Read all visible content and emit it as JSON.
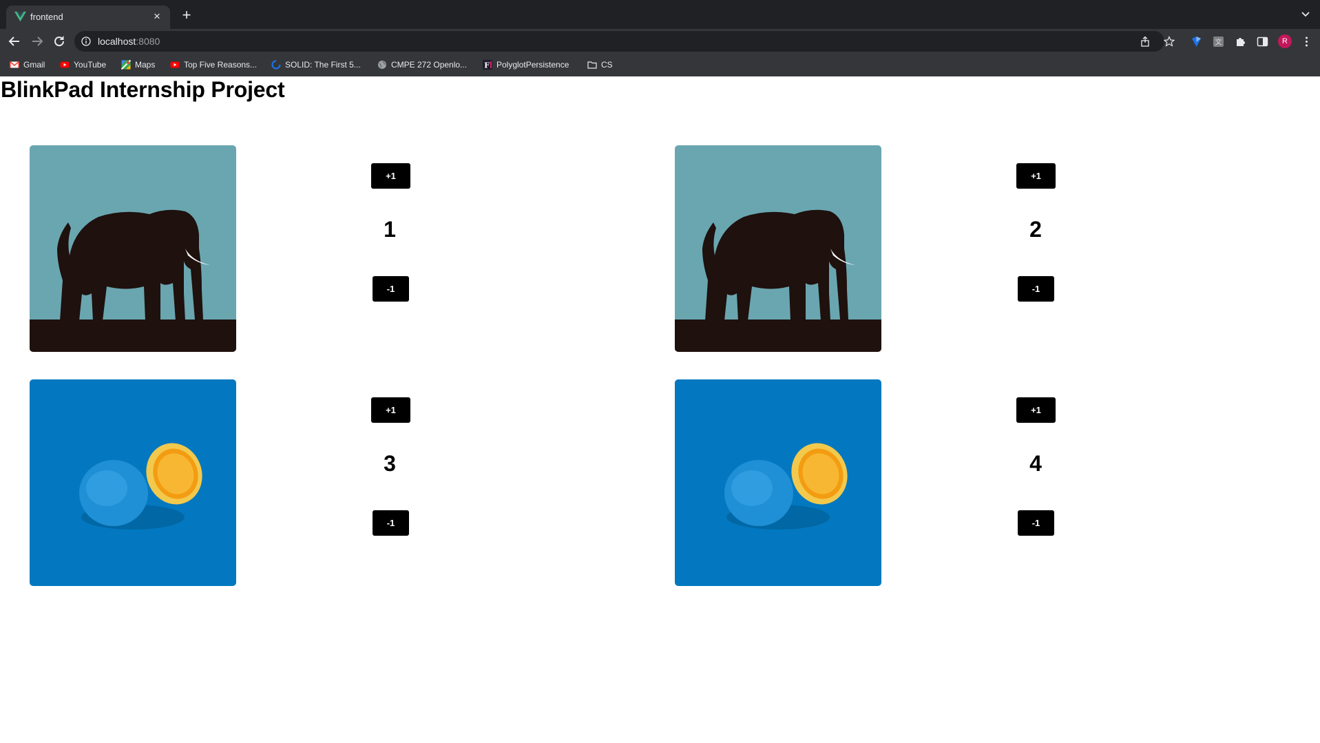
{
  "browser": {
    "tab_title": "frontend",
    "url_host": "localhost",
    "url_port": ":8080",
    "avatar_letter": "R",
    "bookmarks": [
      {
        "label": "Gmail",
        "icon": "gmail-icon"
      },
      {
        "label": "YouTube",
        "icon": "youtube-icon"
      },
      {
        "label": "Maps",
        "icon": "maps-icon"
      },
      {
        "label": "Top Five Reasons...",
        "icon": "youtube-icon"
      },
      {
        "label": "SOLID: The First 5...",
        "icon": "site-icon"
      },
      {
        "label": "CMPE 272 Openlo...",
        "icon": "globe-icon"
      },
      {
        "label": "PolyglotPersistence",
        "icon": "f-icon"
      },
      {
        "label": "CS",
        "icon": "folder-icon"
      }
    ]
  },
  "page": {
    "title": "BlinkPad Internship Project",
    "cards": [
      {
        "image": "elephant-silhouette",
        "plus_label": "+1",
        "count": "1",
        "minus_label": "-1"
      },
      {
        "image": "elephant-silhouette",
        "plus_label": "+1",
        "count": "2",
        "minus_label": "-1"
      },
      {
        "image": "blue-orange",
        "plus_label": "+1",
        "count": "3",
        "minus_label": "-1"
      },
      {
        "image": "blue-orange",
        "plus_label": "+1",
        "count": "4",
        "minus_label": "-1"
      }
    ]
  },
  "colors": {
    "elephant_sky": "#6aa6b0",
    "elephant_ground": "#1e110e",
    "orange_bg": "#0378c0",
    "button_bg": "#000000",
    "accent_vue": "#41b883"
  }
}
